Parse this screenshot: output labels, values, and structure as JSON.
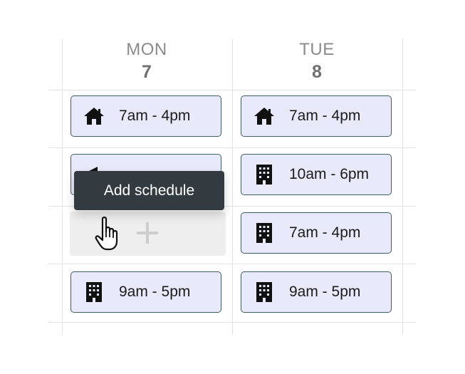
{
  "days": [
    {
      "name": "MON",
      "date": "7"
    },
    {
      "name": "TUE",
      "date": "8"
    }
  ],
  "shifts": {
    "mon_row1": {
      "icon": "home-icon",
      "label": "7am - 4pm"
    },
    "mon_row4": {
      "icon": "building-icon",
      "label": "9am - 5pm"
    },
    "tue_row1": {
      "icon": "home-icon",
      "label": "7am - 4pm"
    },
    "tue_row2": {
      "icon": "building-icon",
      "label": "10am - 6pm"
    },
    "tue_row3": {
      "icon": "building-icon",
      "label": "7am - 4pm"
    },
    "tue_row4": {
      "icon": "building-icon",
      "label": "9am - 5pm"
    }
  },
  "tooltip": {
    "text": "Add schedule"
  },
  "empty_slot": {
    "icon": "plus-icon"
  },
  "colors": {
    "shift_bg": "#e8e9fb",
    "shift_border": "#3e5f5f",
    "tooltip_bg": "#333b41",
    "grid": "#e3e3e3",
    "empty_slot_bg": "#eeeeee"
  }
}
